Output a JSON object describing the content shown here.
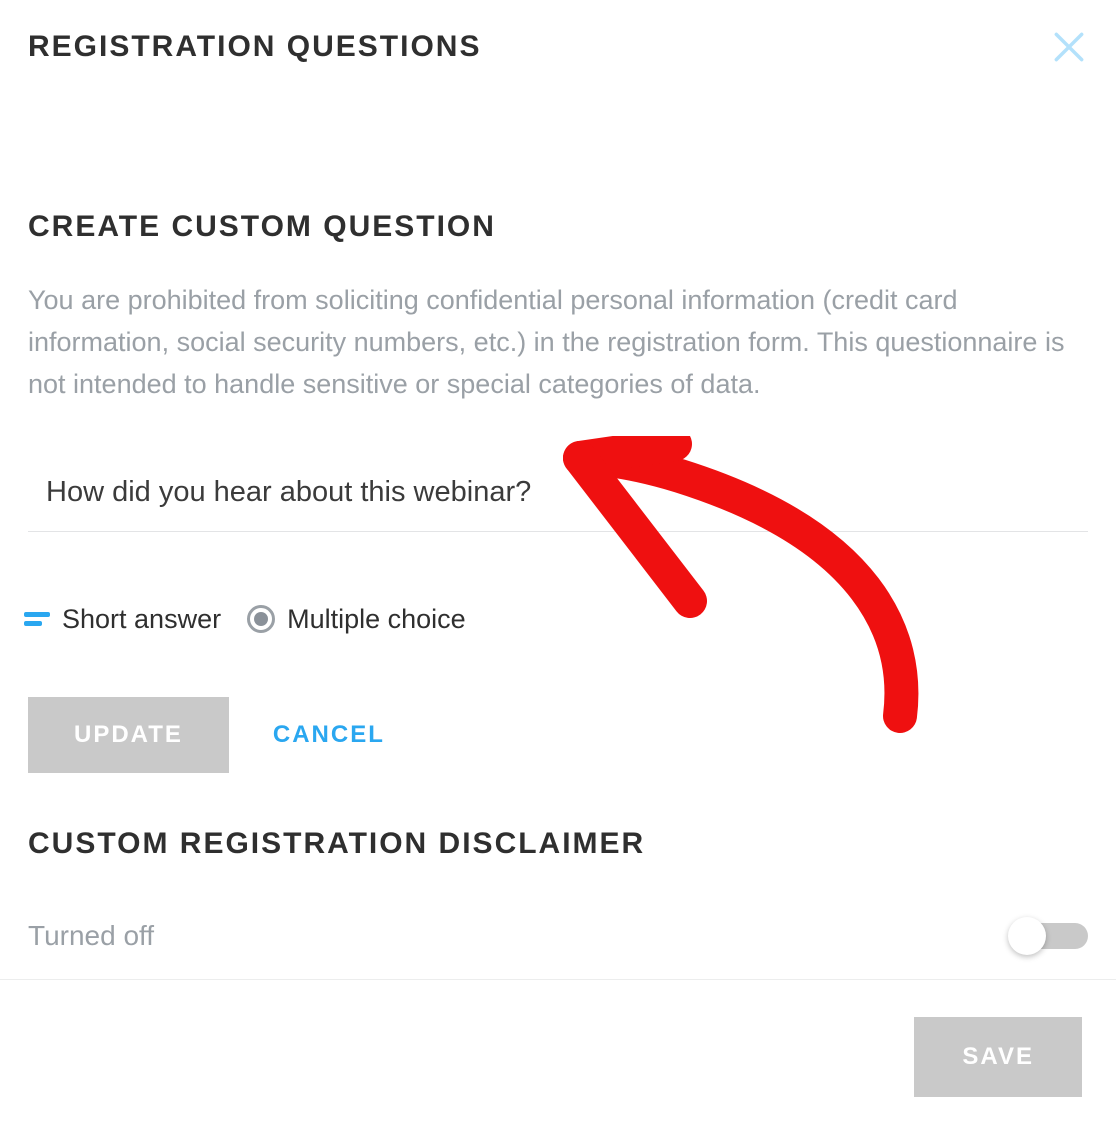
{
  "dialog": {
    "title": "REGISTRATION QUESTIONS"
  },
  "section": {
    "title": "CREATE CUSTOM QUESTION",
    "description": "You are prohibited from soliciting confidential personal information (credit card information, social security numbers, etc.) in the registration form. This questionnaire is not intended to handle sensitive or special categories of data.",
    "questionValue": "How did you hear about this webinar?",
    "types": {
      "shortAnswer": "Short answer",
      "multipleChoice": "Multiple choice"
    },
    "buttons": {
      "update": "UPDATE",
      "cancel": "CANCEL"
    }
  },
  "disclaimer": {
    "title": "CUSTOM REGISTRATION DISCLAIMER",
    "status": "Turned off"
  },
  "footer": {
    "save": "SAVE"
  }
}
